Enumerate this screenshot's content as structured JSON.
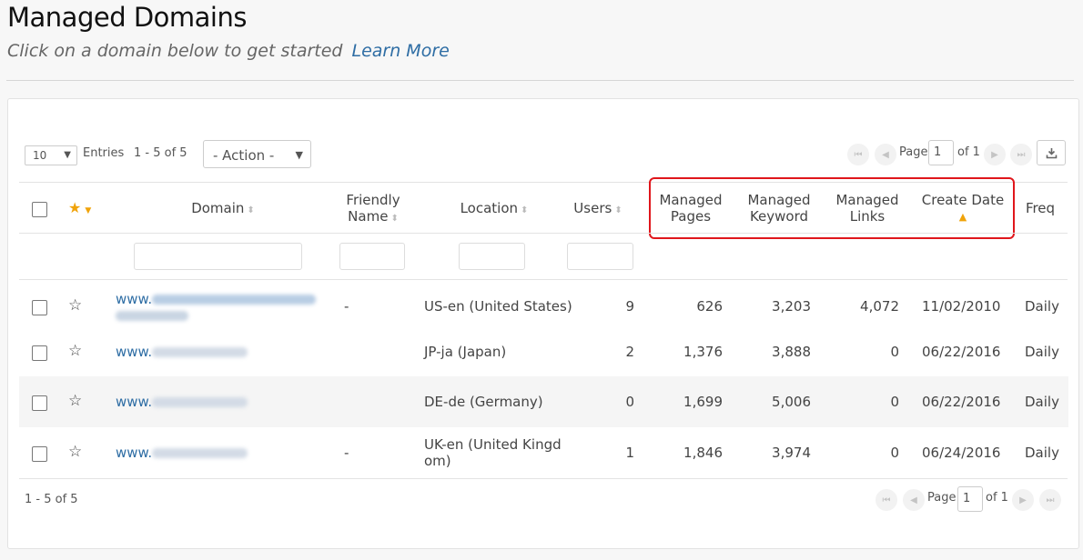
{
  "header": {
    "title": "Managed Domains",
    "subtitle": "Click on a domain below to get started",
    "learn_more": "Learn More"
  },
  "toolbar": {
    "entries_value": "10",
    "entries_label": "Entries",
    "range": "1 - 5 of 5",
    "action_placeholder": "- Action -",
    "page_label": "Page",
    "page_value": "1",
    "of_label": "of 1"
  },
  "columns": {
    "domain": "Domain",
    "friendly_name_1": "Friendly",
    "friendly_name_2": "Name",
    "location": "Location",
    "users": "Users",
    "managed_pages_1": "Managed",
    "managed_pages_2": "Pages",
    "managed_keyword_1": "Managed",
    "managed_keyword_2": "Keyword",
    "managed_links_1": "Managed",
    "managed_links_2": "Links",
    "create_date": "Create Date",
    "freq": "Freq"
  },
  "rows": [
    {
      "domain_prefix": "www.",
      "friendly": "-",
      "location": "US-en (United States)",
      "users": "9",
      "pages": "626",
      "keyword": "3,203",
      "links": "4,072",
      "created": "11/02/2010",
      "freq": "Daily"
    },
    {
      "domain_prefix": "www.",
      "friendly": "",
      "location": "JP-ja (Japan)",
      "users": "2",
      "pages": "1,376",
      "keyword": "3,888",
      "links": "0",
      "created": "06/22/2016",
      "freq": "Daily"
    },
    {
      "domain_prefix": "www.",
      "friendly": "",
      "location": "DE-de (Germany)",
      "users": "0",
      "pages": "1,699",
      "keyword": "5,006",
      "links": "0",
      "created": "06/22/2016",
      "freq": "Daily"
    },
    {
      "domain_prefix": "www.",
      "friendly": "-",
      "location_1": "UK-en (United Kingd",
      "location_2": "om)",
      "users": "1",
      "pages": "1,846",
      "keyword": "3,974",
      "links": "0",
      "created": "06/24/2016",
      "freq": "Daily"
    }
  ],
  "footer": {
    "range": "1 - 5 of 5",
    "page_label": "Page",
    "page_value": "1",
    "of_label": "of 1"
  },
  "colors": {
    "link": "#2e6da4",
    "star_active": "#f0a30a",
    "highlight": "#e0161c"
  }
}
